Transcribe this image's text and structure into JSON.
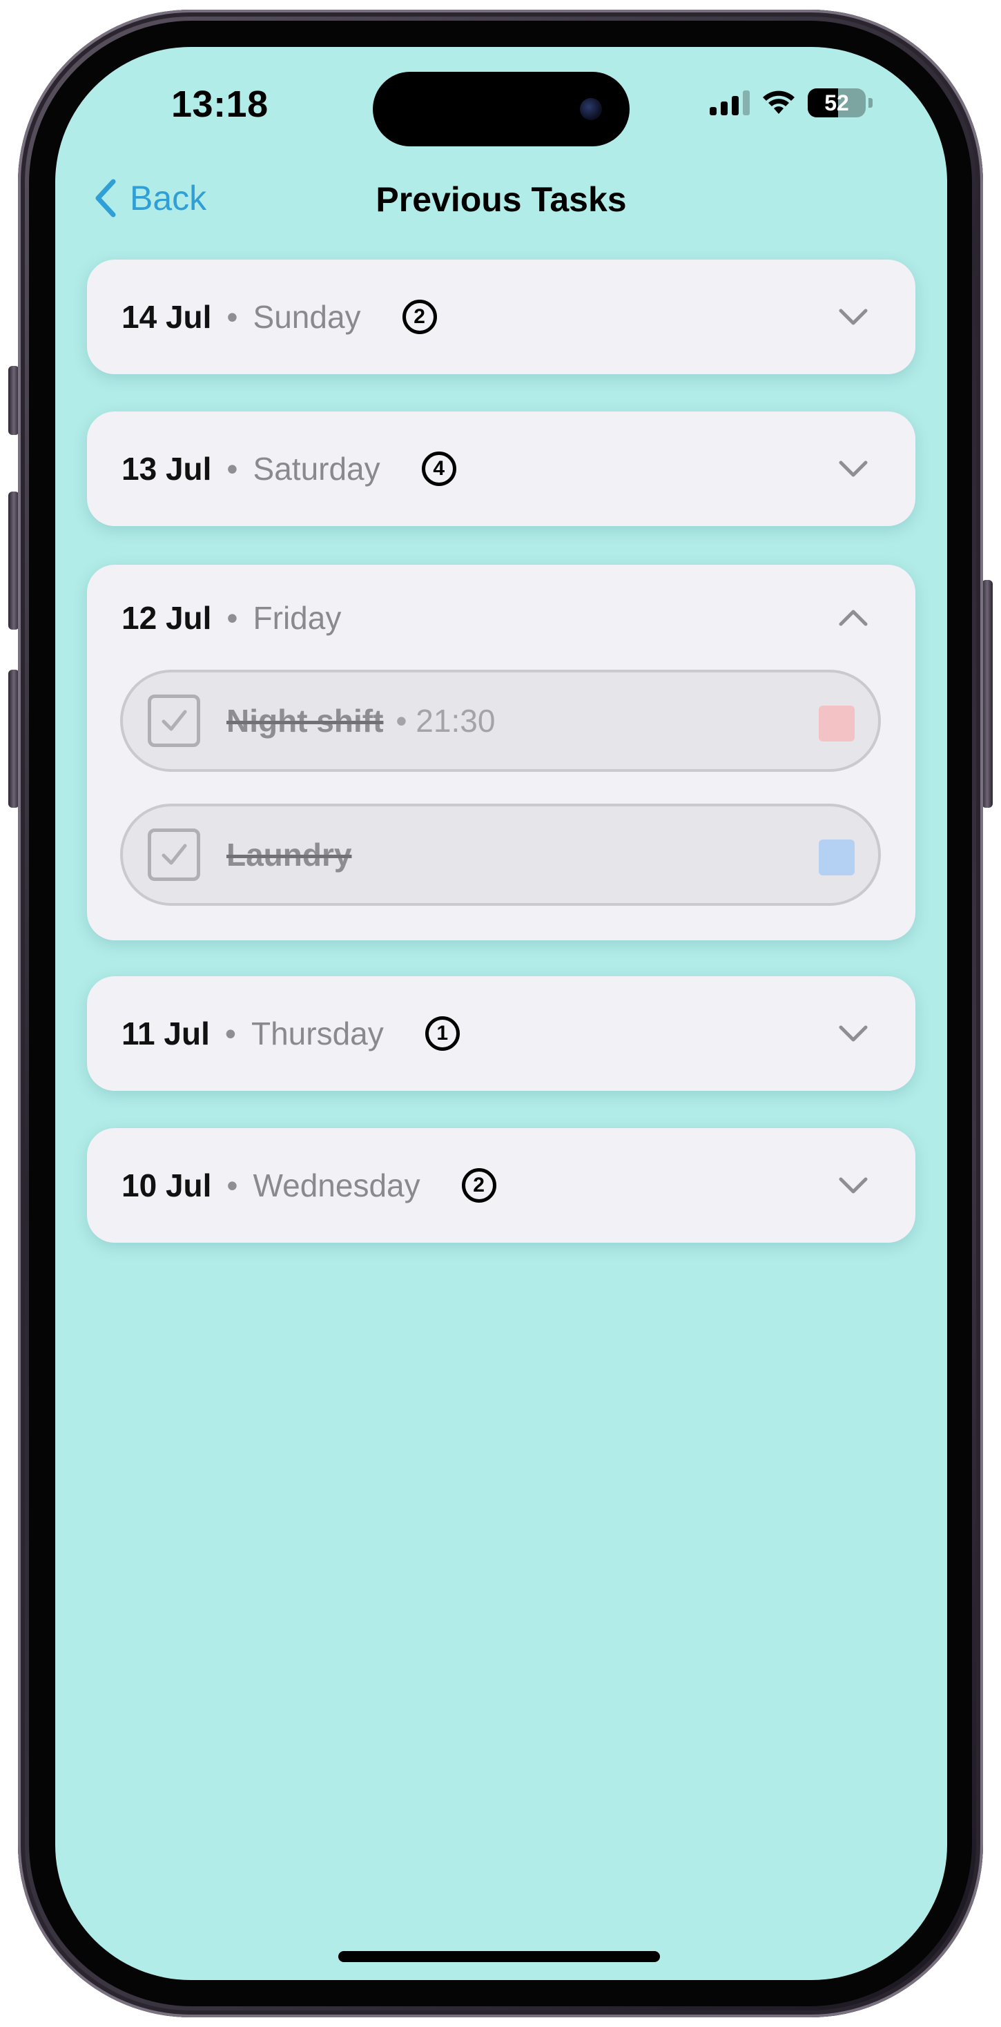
{
  "status_bar": {
    "time": "13:18",
    "battery": "52",
    "battery_level": 0.52
  },
  "nav": {
    "back_label": "Back",
    "title": "Previous Tasks"
  },
  "days": [
    {
      "date": "14 Jul",
      "weekday": "Sunday",
      "count": "2",
      "expanded": false
    },
    {
      "date": "13 Jul",
      "weekday": "Saturday",
      "count": "4",
      "expanded": false
    },
    {
      "date": "12 Jul",
      "weekday": "Friday",
      "count": "",
      "expanded": true,
      "tasks": [
        {
          "title": "Night shift",
          "time": "• 21:30",
          "completed": true,
          "color": "#f2c2c4"
        },
        {
          "title": "Laundry",
          "time": "",
          "completed": true,
          "color": "#b4d1f4"
        }
      ]
    },
    {
      "date": "11 Jul",
      "weekday": "Thursday",
      "count": "1",
      "expanded": false
    },
    {
      "date": "10 Jul",
      "weekday": "Wednesday",
      "count": "2",
      "expanded": false
    }
  ],
  "colors": {
    "screen_background": "#b2ece9",
    "card_background": "#f1f1f6",
    "accent": "#2f9fd6"
  },
  "icons": {
    "back": "chevron-left-icon",
    "collapsed": "chevron-down-icon",
    "expanded": "chevron-up-icon",
    "check": "checkmark-icon"
  }
}
